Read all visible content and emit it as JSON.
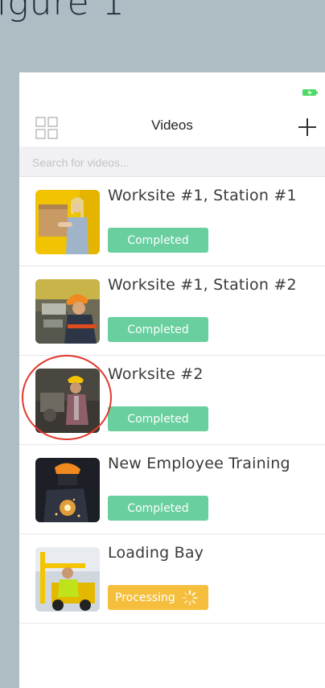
{
  "figure": {
    "title": "igure 1"
  },
  "header": {
    "title": "Videos",
    "left_icon": "grid-icon",
    "right_icon": "plus-icon"
  },
  "status": {
    "battery_icon": "battery-charging-icon",
    "battery_color": "#4cd964"
  },
  "search": {
    "placeholder": "Search for videos..."
  },
  "colors": {
    "completed": "#69cf9e",
    "processing": "#f5bf3d",
    "annotation": "#e03a2c"
  },
  "videos": [
    {
      "title": "Worksite #1, Station #1",
      "status": "Completed"
    },
    {
      "title": "Worksite #1, Station #2",
      "status": "Completed"
    },
    {
      "title": "Worksite #2",
      "status": "Completed"
    },
    {
      "title": "New Employee Training",
      "status": "Completed"
    },
    {
      "title": "Loading Bay",
      "status": "Processing"
    }
  ]
}
